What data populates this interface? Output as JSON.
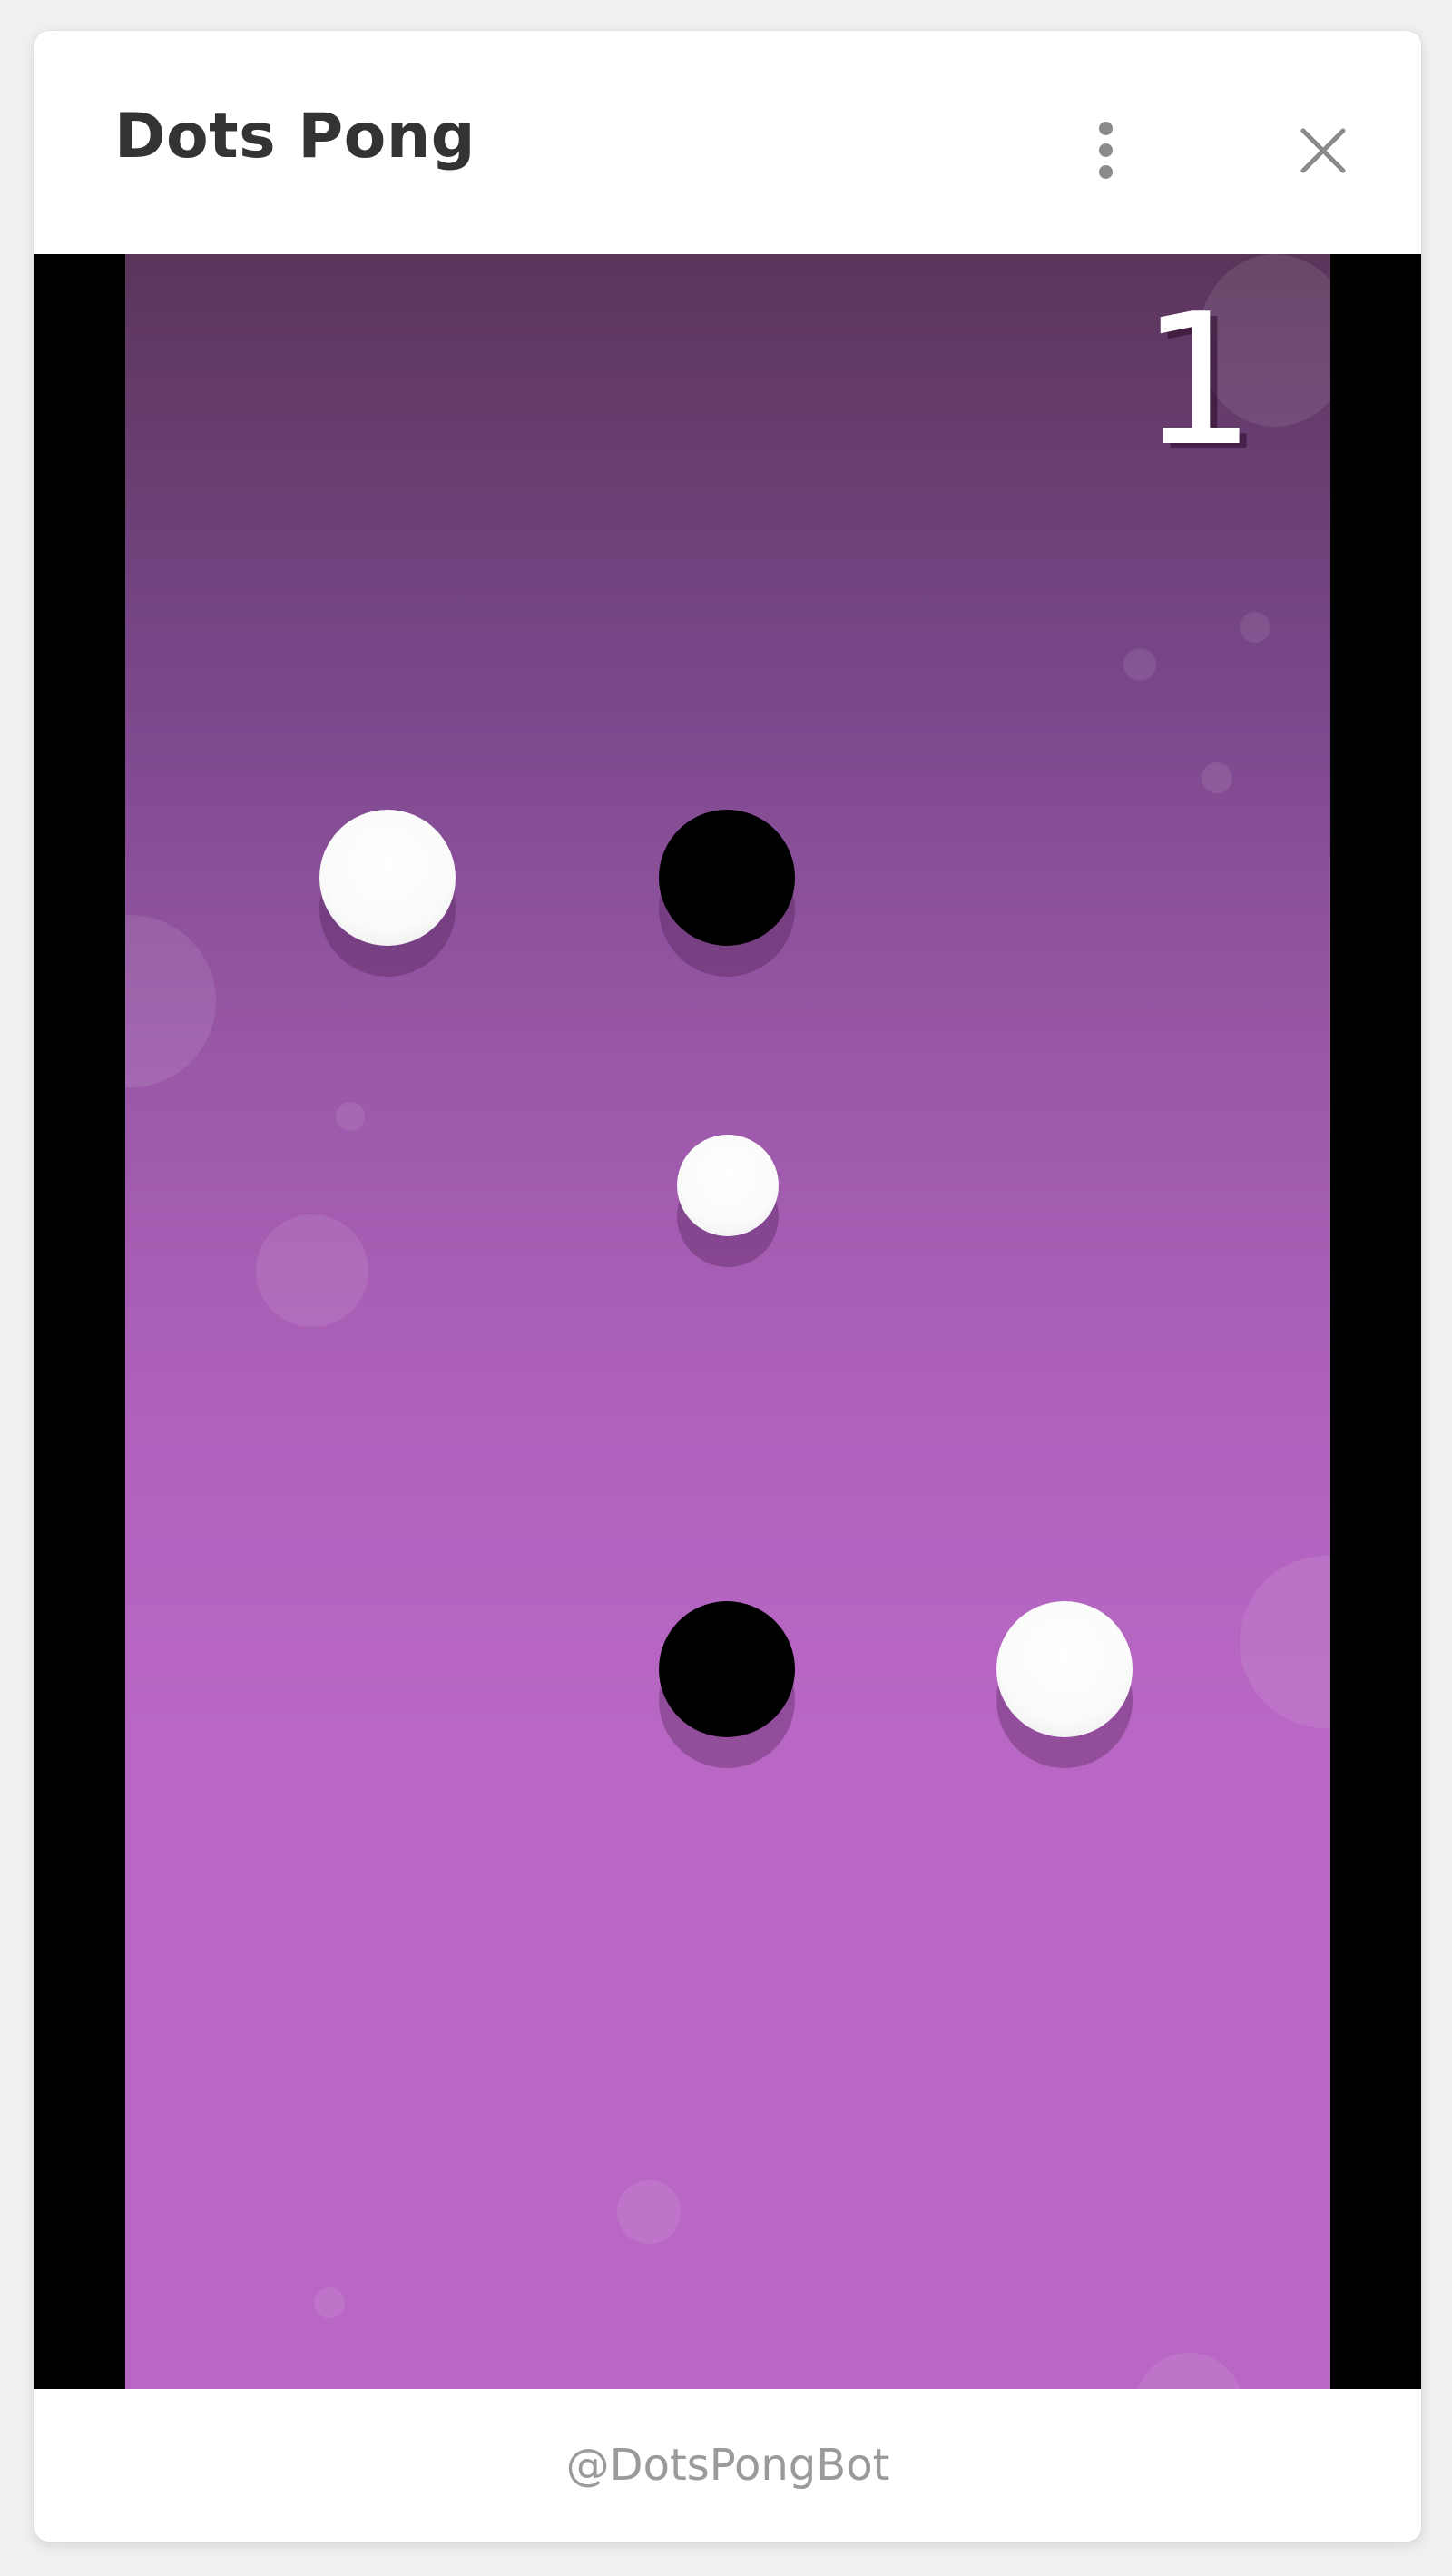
{
  "window": {
    "title": "Dots Pong"
  },
  "header": {
    "menu_icon": "vertical-dots-icon",
    "close_icon": "close-icon"
  },
  "game": {
    "score": "1",
    "colors": {
      "playfield_top": "#5a355a",
      "playfield_bottom": "#b868c4",
      "white_dot": "#ffffff",
      "black_dot": "#000000",
      "side_bars": "#000000"
    },
    "dots": [
      {
        "type": "white-paddle"
      },
      {
        "type": "black-paddle"
      },
      {
        "type": "ball"
      },
      {
        "type": "black-paddle"
      },
      {
        "type": "white-paddle"
      }
    ]
  },
  "footer": {
    "bot_handle": "@DotsPongBot"
  }
}
